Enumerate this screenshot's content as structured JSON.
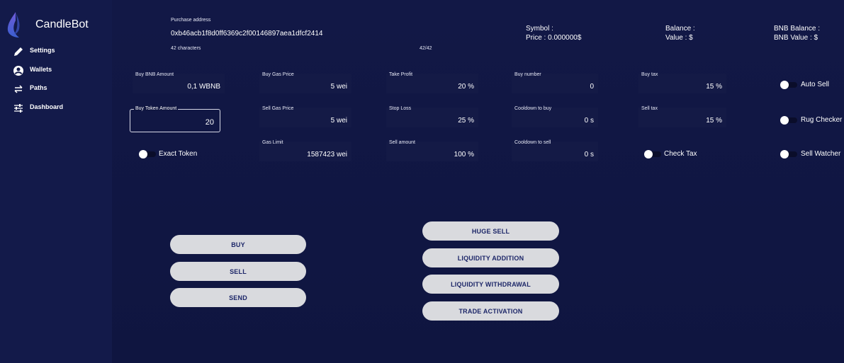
{
  "app": {
    "name": "CandleBot"
  },
  "sidebar": {
    "items": [
      {
        "label": "Settings",
        "icon": "pencil-icon"
      },
      {
        "label": "Wallets",
        "icon": "account-icon"
      },
      {
        "label": "Paths",
        "icon": "swap-arrows-icon"
      },
      {
        "label": "Dashboard",
        "icon": "sliders-icon"
      }
    ]
  },
  "address": {
    "label": "Purchase address",
    "value": "0xb46acb1f8d0ff6369c2f00146897aea1dfcf2414",
    "helper": "42 characters",
    "counter": "42/42"
  },
  "info": {
    "symbol": "Symbol :",
    "price": "Price : 0.000000$",
    "balance": "Balance :",
    "value": "Value : $",
    "bnb_balance": "BNB Balance :",
    "bnb_value": "BNB Value : $"
  },
  "fields": {
    "buy_bnb_amount": {
      "label": "Buy BNB Amount",
      "value": "0,1 WBNB"
    },
    "buy_token_amount": {
      "label": "Buy Token Amount",
      "value": "20"
    },
    "buy_gas_price": {
      "label": "Buy Gas Price",
      "value": "5 wei"
    },
    "sell_gas_price": {
      "label": "Sell Gas Price",
      "value": "5 wei"
    },
    "gas_limit": {
      "label": "Gas Limit",
      "value": "1587423 wei"
    },
    "take_profit": {
      "label": "Take Profit",
      "value": "20 %"
    },
    "stop_loss": {
      "label": "Stop Loss",
      "value": "25 %"
    },
    "sell_amount": {
      "label": "Sell amount",
      "value": "100 %"
    },
    "buy_number": {
      "label": "Buy number",
      "value": "0"
    },
    "cooldown_buy": {
      "label": "Cooldown to buy",
      "value": "0 s"
    },
    "cooldown_sell": {
      "label": "Cooldown to sell",
      "value": "0 s"
    },
    "buy_tax": {
      "label": "Buy tax",
      "value": "15 %"
    },
    "sell_tax": {
      "label": "Sell tax",
      "value": "15 %"
    }
  },
  "toggles": {
    "exact_token": "Exact Token",
    "check_tax": "Check Tax",
    "auto_sell": "Auto Sell",
    "rug_checker": "Rug Checker",
    "sell_watcher": "Sell Watcher"
  },
  "buttons": {
    "buy": "BUY",
    "sell": "SELL",
    "send": "SEND",
    "huge_sell": "HUGE SELL",
    "liquidity_addition": "LIQUIDITY ADDITION",
    "liquidity_withdrawal": "LIQUIDITY WITHDRAWAL",
    "trade_activation": "TRADE ACTIVATION"
  },
  "colors": {
    "background": "#0f1338",
    "sidebar": "#131a4a",
    "button_bg": "#d9dade",
    "button_text": "#1c2668",
    "logo_gradient": [
      "#6f5bd8",
      "#3f6fd8"
    ]
  }
}
